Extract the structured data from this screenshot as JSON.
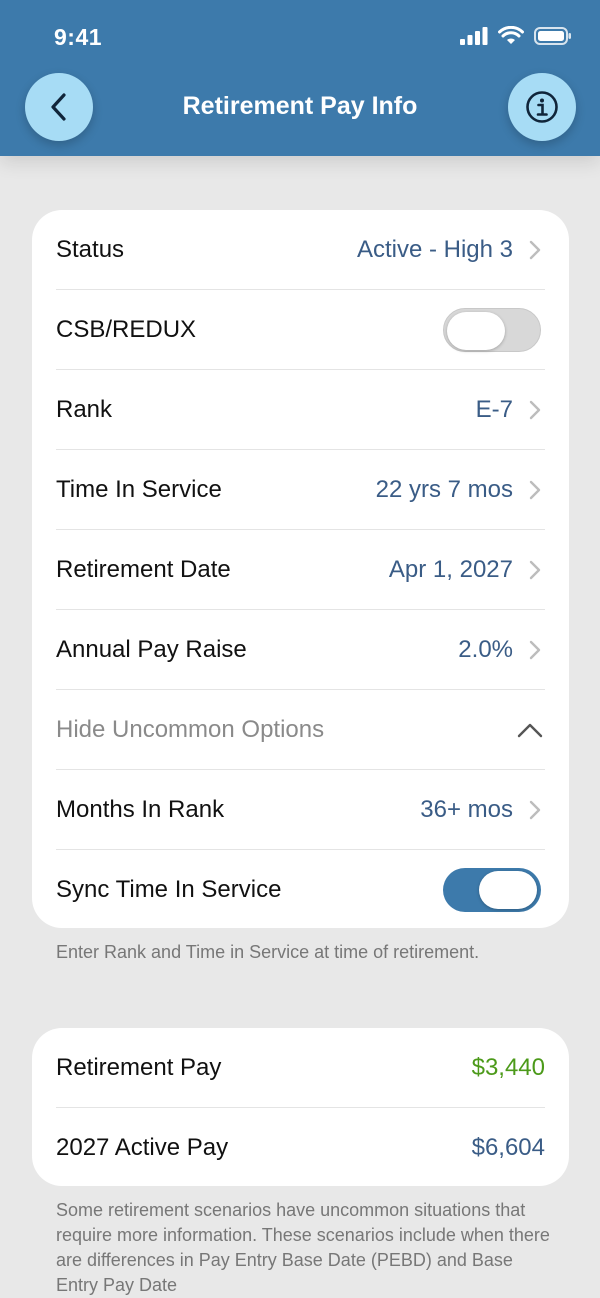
{
  "status_bar": {
    "time": "9:41"
  },
  "nav": {
    "title": "Retirement Pay Info"
  },
  "settings": {
    "status": {
      "label": "Status",
      "value": "Active - High 3"
    },
    "csb_redux": {
      "label": "CSB/REDUX",
      "enabled": false
    },
    "rank": {
      "label": "Rank",
      "value": "E-7"
    },
    "time_in_service": {
      "label": "Time In Service",
      "value": "22 yrs 7 mos"
    },
    "retirement_date": {
      "label": "Retirement Date",
      "value": "Apr 1, 2027"
    },
    "annual_pay_raise": {
      "label": "Annual Pay Raise",
      "value": "2.0%"
    },
    "uncommon_toggle": {
      "label": "Hide Uncommon Options"
    },
    "months_in_rank": {
      "label": "Months In Rank",
      "value": "36+ mos"
    },
    "sync_time": {
      "label": "Sync Time In Service",
      "enabled": true
    }
  },
  "note1": "Enter Rank and Time in Service at time of retirement.",
  "pay": {
    "retirement_pay": {
      "label": "Retirement Pay",
      "value": "$3,440"
    },
    "active_pay": {
      "label": "2027 Active Pay",
      "value": "$6,604"
    }
  },
  "note2": "Some retirement scenarios have uncommon situations that require more information. These scenarios include when there are differences in Pay Entry Base Date (PEBD) and Base Entry Pay Date",
  "colors": {
    "header": "#3d7aab",
    "button": "#a7dcf5",
    "value": "#3a5c86",
    "positive": "#4c9a1a"
  }
}
